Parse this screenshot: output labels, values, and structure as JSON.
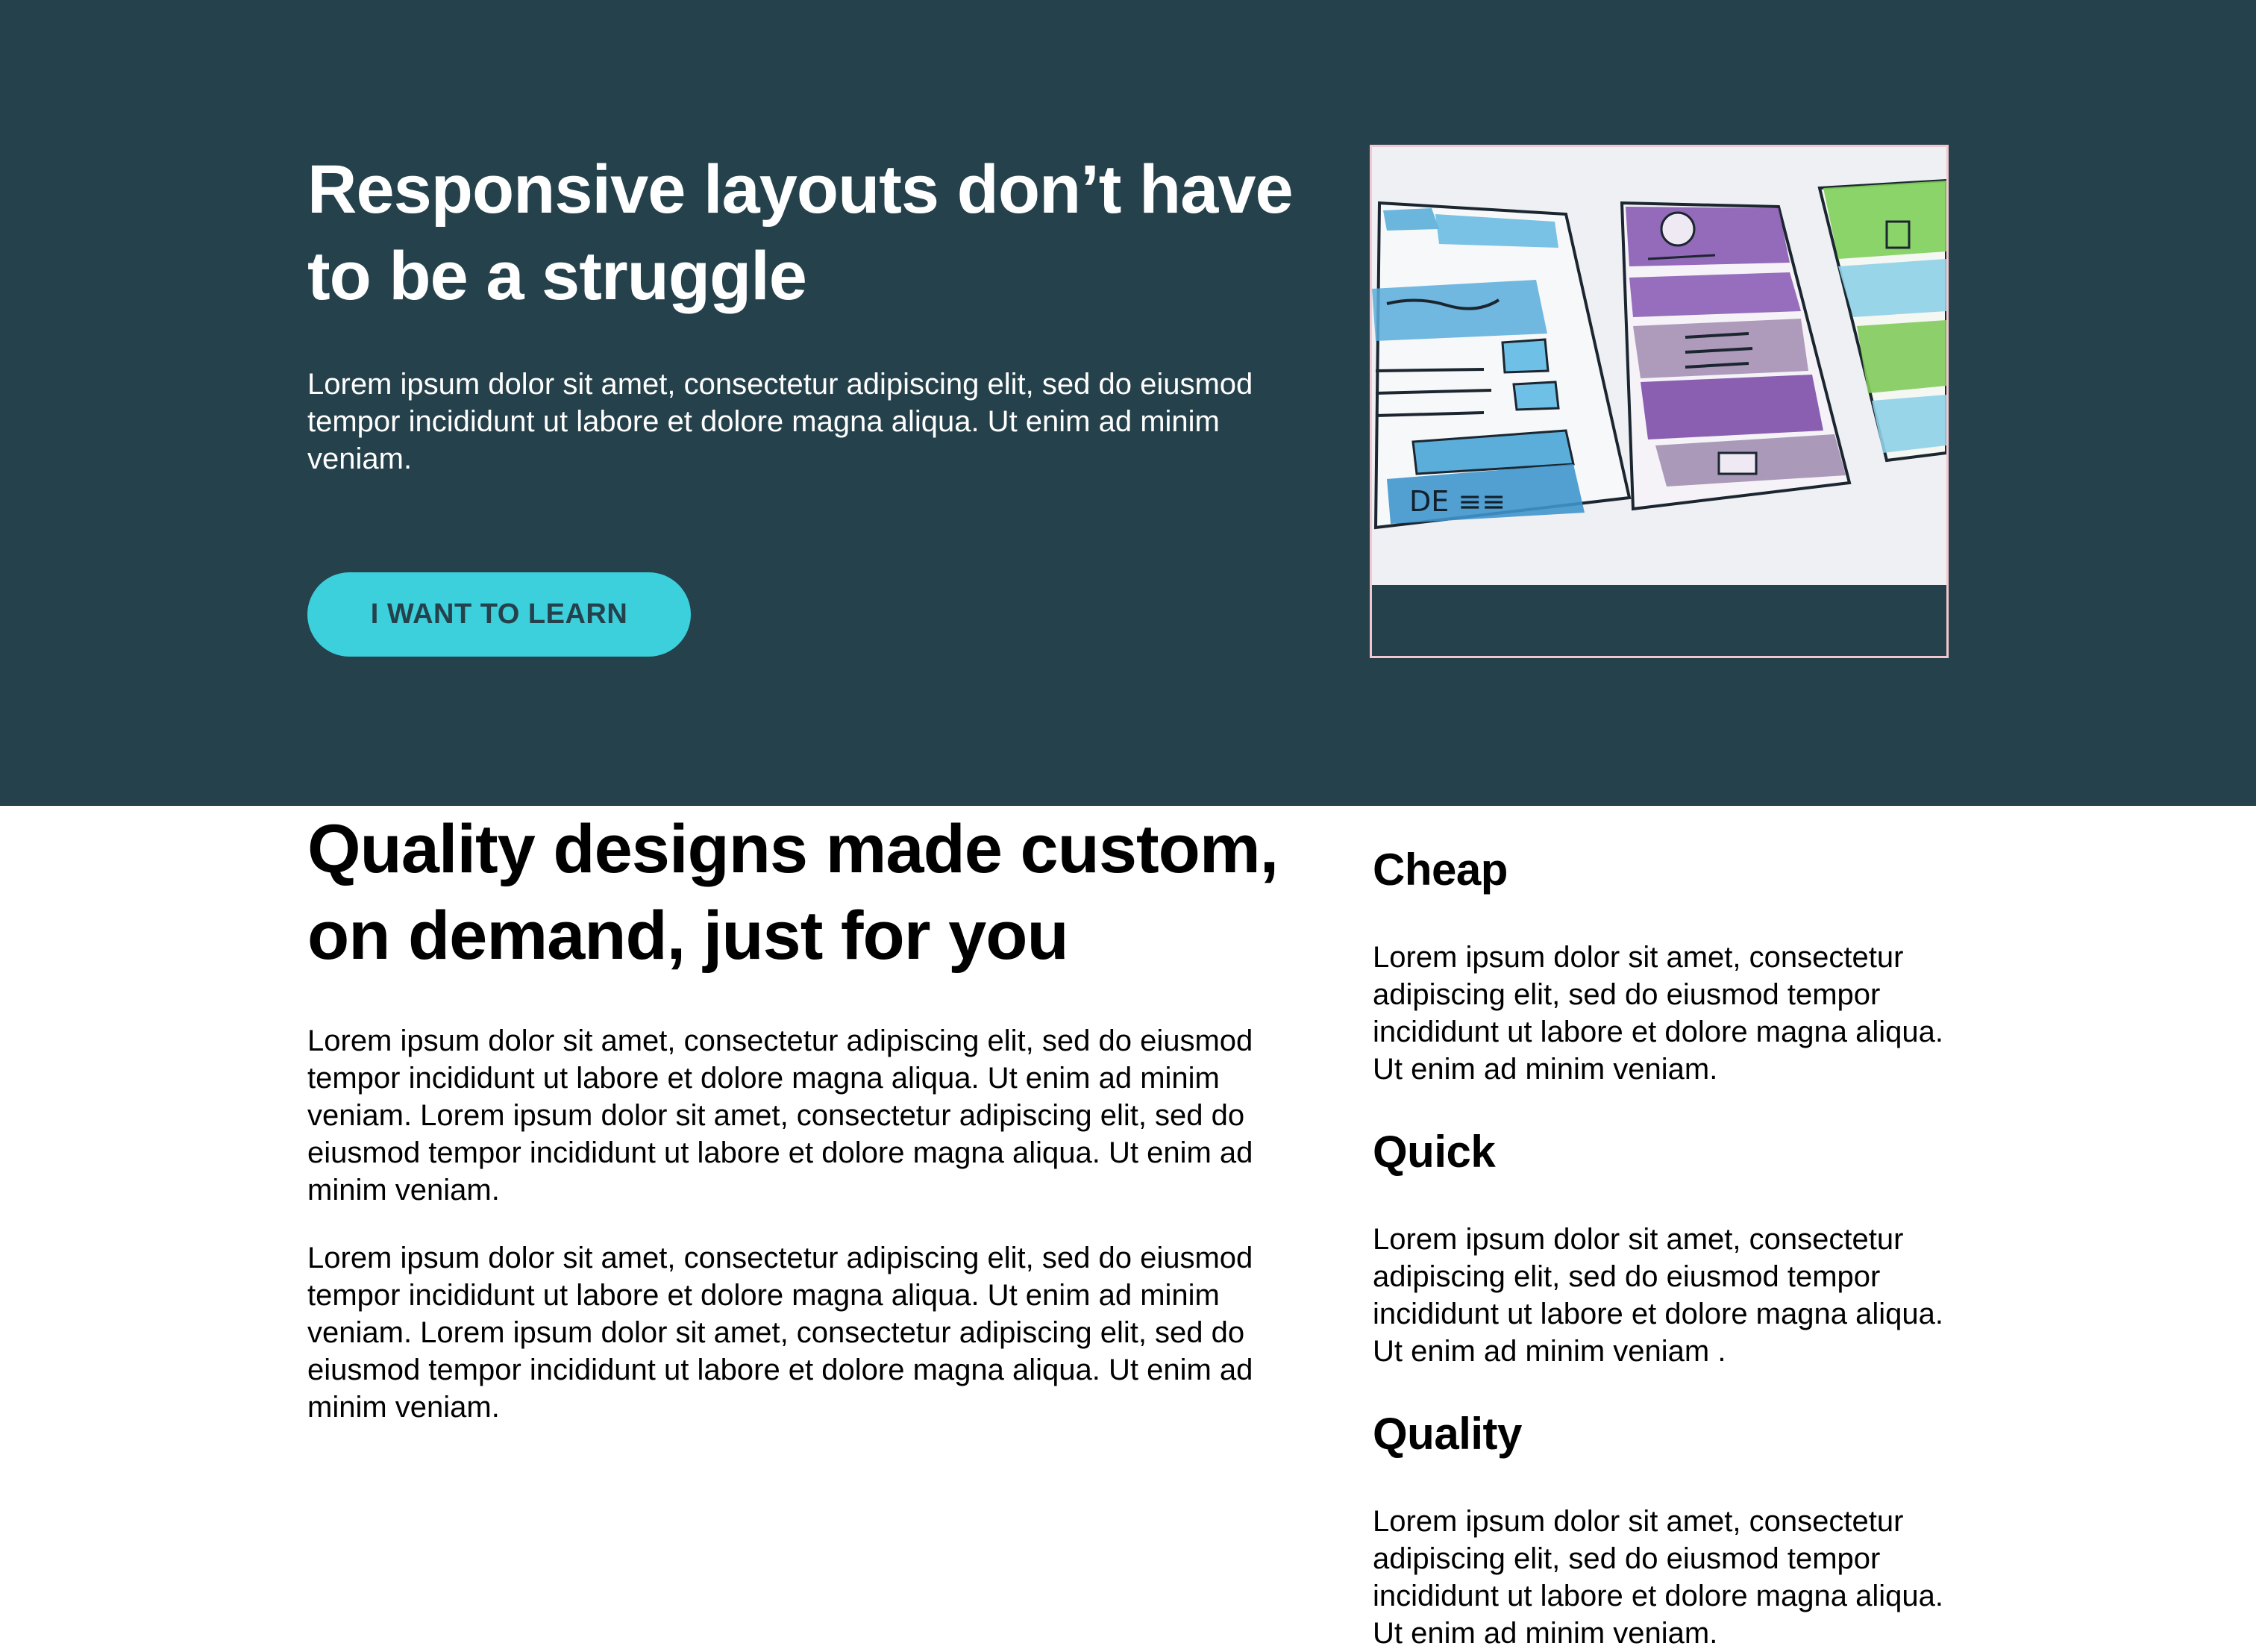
{
  "hero": {
    "title": "Responsive layouts don’t have to be a struggle",
    "text": "Lorem ipsum dolor sit amet, consectetur adipiscing elit, sed do eiusmod tempor incididunt ut labore et dolore magna aliqua. Ut enim ad minim veniam.",
    "cta_label": "I WANT TO LEARN",
    "background_color": "#25414b",
    "cta_color": "#3ccfdc",
    "image_icon": "wireframe-sketch-image"
  },
  "main": {
    "title": "Quality designs made custom, on demand, just for you",
    "paragraphs": [
      "Lorem ipsum dolor sit amet, consectetur adipiscing elit, sed do eiusmod tempor incididunt ut labore et dolore magna aliqua. Ut enim ad minim veniam. Lorem ipsum dolor sit amet, consectetur adipiscing elit, sed do eiusmod tempor incididunt ut labore et dolore magna aliqua. Ut enim ad minim veniam.",
      "Lorem ipsum dolor sit amet, consectetur adipiscing elit, sed do eiusmod tempor incididunt ut labore et dolore magna aliqua. Ut enim ad minim veniam. Lorem ipsum dolor sit amet, consectetur adipiscing elit, sed do eiusmod tempor incididunt ut labore et dolore magna aliqua. Ut enim ad minim veniam."
    ]
  },
  "features": [
    {
      "title": "Cheap",
      "text": "Lorem ipsum dolor sit amet, consectetur adipiscing elit, sed do eiusmod tempor incididunt ut labore et dolore magna aliqua. Ut enim ad minim veniam."
    },
    {
      "title": "Quick",
      "text": "Lorem ipsum dolor sit amet, consectetur adipiscing elit, sed do eiusmod tempor incididunt ut labore et dolore magna aliqua. Ut enim ad minim veniam ."
    },
    {
      "title": "Quality",
      "text": "Lorem ipsum dolor sit amet, consectetur adipiscing elit, sed do eiusmod tempor incididunt ut labore et dolore magna aliqua. Ut enim ad minim veniam."
    }
  ]
}
